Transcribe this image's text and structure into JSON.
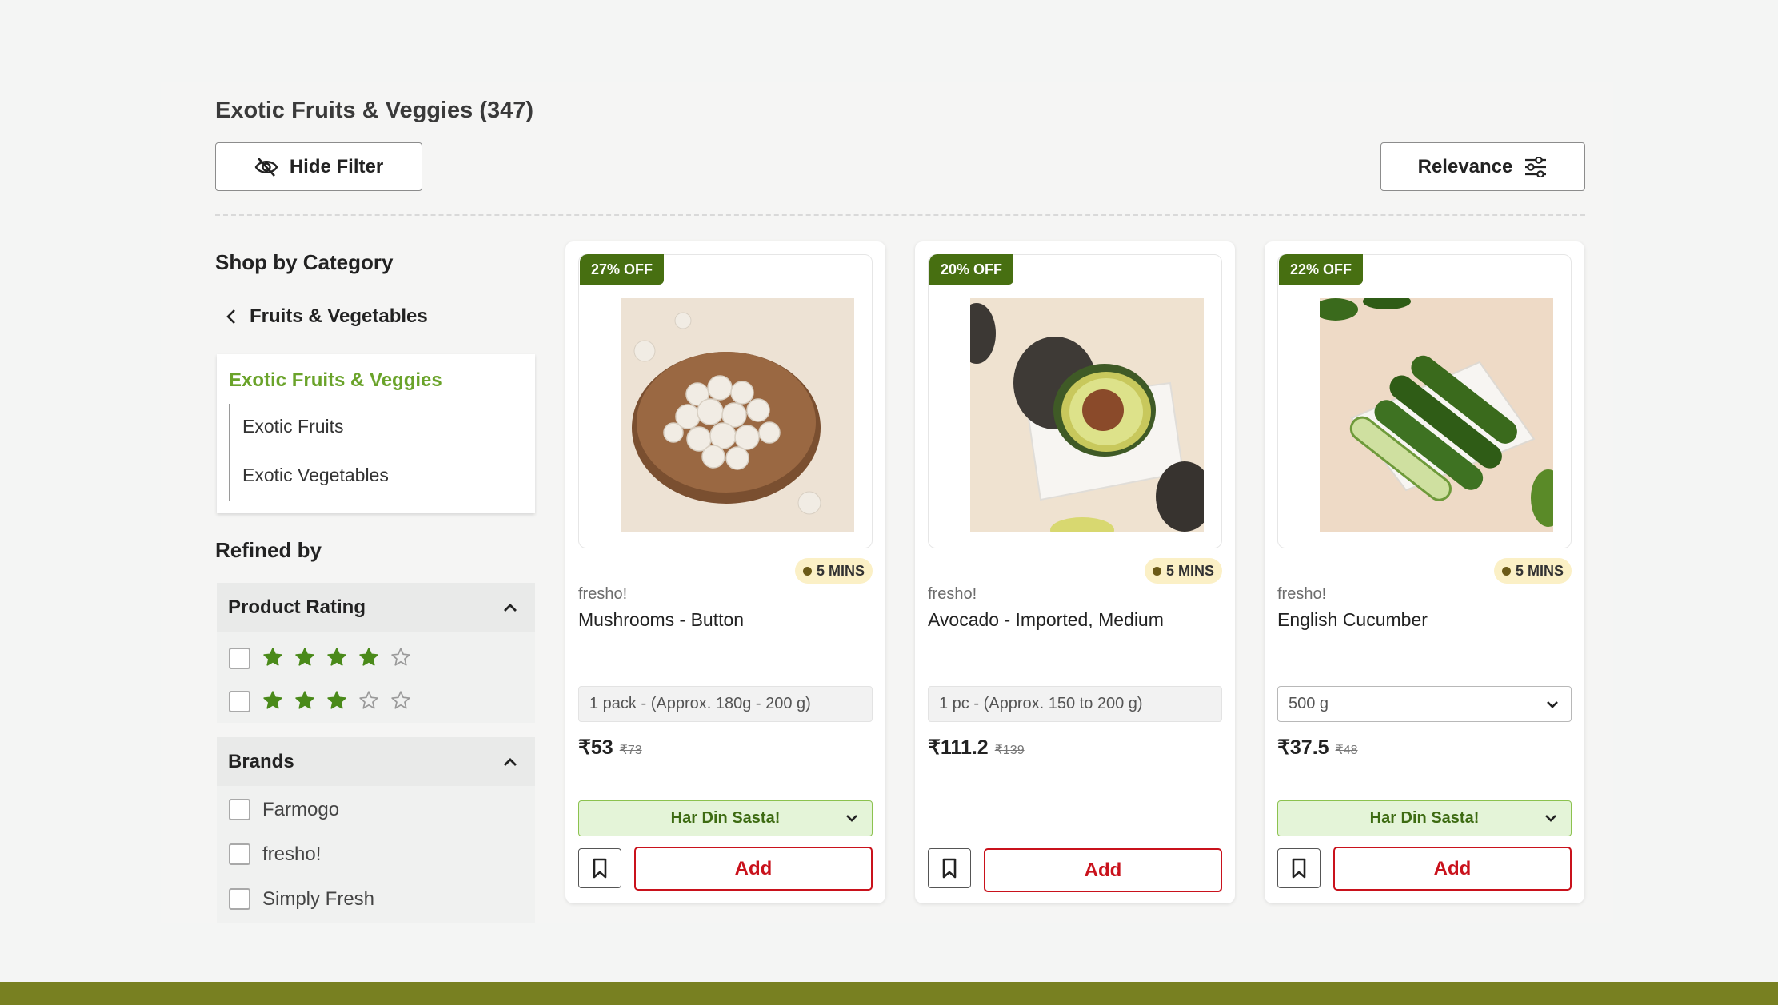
{
  "page": {
    "title": "Exotic Fruits & Veggies (347)",
    "hide_filter_label": "Hide Filter",
    "sort_label": "Relevance"
  },
  "sidebar": {
    "shop_by_category": "Shop by Category",
    "parent_category": "Fruits & Vegetables",
    "active_category": "Exotic Fruits & Veggies",
    "subcategories": [
      "Exotic Fruits",
      "Exotic Vegetables"
    ],
    "refined_by": "Refined by",
    "rating_filter": {
      "title": "Product Rating",
      "options": [
        {
          "filled_stars": 4,
          "total_stars": 5
        },
        {
          "filled_stars": 3,
          "total_stars": 5
        }
      ]
    },
    "brands_filter": {
      "title": "Brands",
      "options": [
        "Farmogo",
        "fresho!",
        "Simply Fresh"
      ]
    }
  },
  "products": [
    {
      "discount": "27% OFF",
      "delivery_time": "5 MINS",
      "brand": "fresho!",
      "name": "Mushrooms - Button",
      "pack": "1 pack - (Approx. 180g - 200 g)",
      "price": "₹53",
      "mrp": "₹73",
      "offer": "Har Din Sasta!",
      "add_label": "Add"
    },
    {
      "discount": "20% OFF",
      "delivery_time": "5 MINS",
      "brand": "fresho!",
      "name": "Avocado - Imported, Medium",
      "pack": "1 pc - (Approx. 150 to 200 g)",
      "price": "₹111.2",
      "mrp": "₹139",
      "add_label": "Add"
    },
    {
      "discount": "22% OFF",
      "delivery_time": "5 MINS",
      "brand": "fresho!",
      "name": "English Cucumber",
      "pack": "500 g",
      "price": "₹37.5",
      "mrp": "₹48",
      "offer": "Har Din Sasta!",
      "add_label": "Add"
    }
  ],
  "colors": {
    "accent_green": "#6aa32a",
    "discount_badge": "#476f11",
    "add_red": "#c9121c",
    "star_green": "#4a8a1a",
    "footer_olive": "#788021"
  },
  "icons": {
    "hide_filter": "eye-slash-icon",
    "sort": "sliders-icon",
    "back": "chevron-left-icon",
    "collapse": "chevron-up-icon",
    "save": "bookmark-icon",
    "dropdown": "chevron-down-icon"
  }
}
